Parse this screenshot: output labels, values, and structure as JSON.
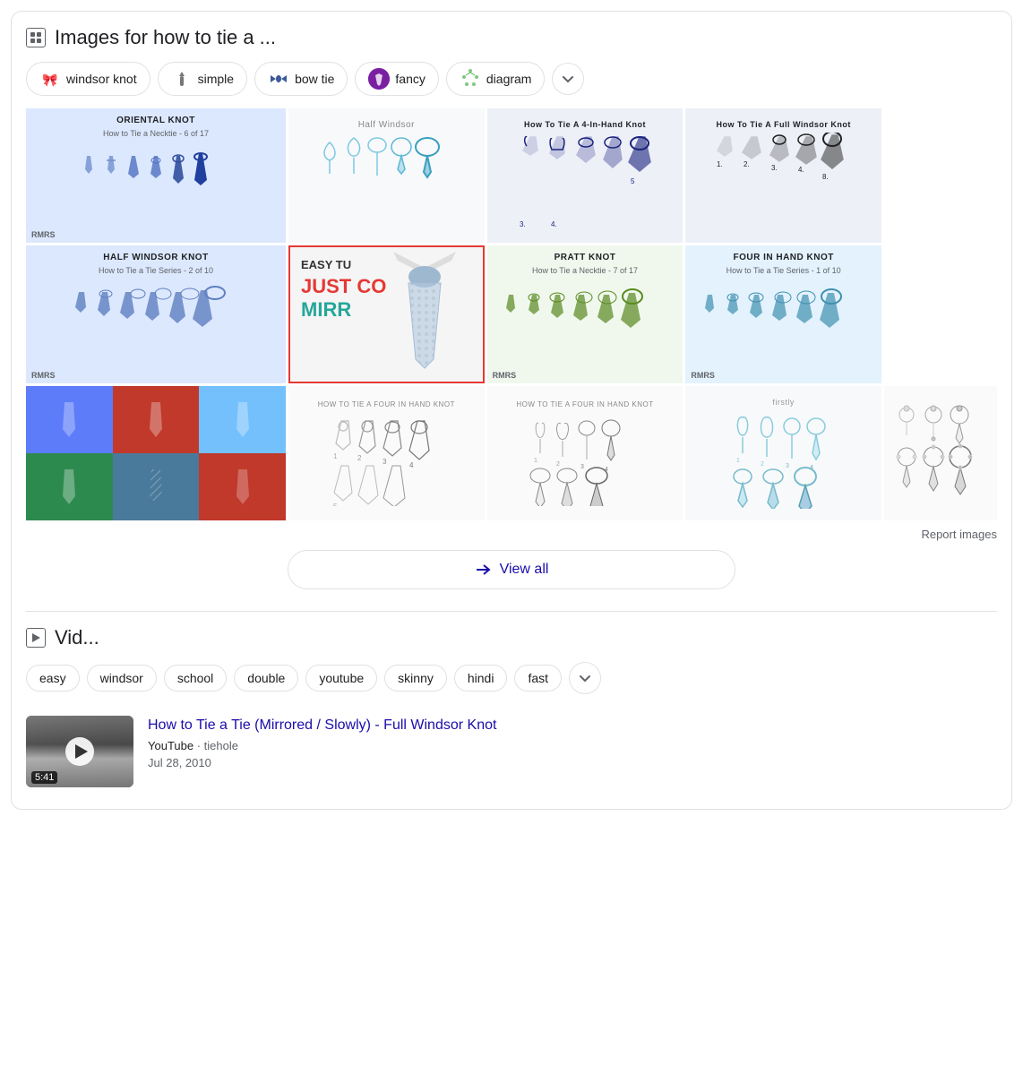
{
  "images_section": {
    "header_title": "Images for how to tie a ...",
    "header_icon": "image-icon",
    "chips": [
      {
        "label": "windsor knot",
        "icon_type": "tie-icon"
      },
      {
        "label": "simple",
        "icon_type": "tie-icon"
      },
      {
        "label": "bow tie",
        "icon_type": "tie-icon"
      },
      {
        "label": "fancy",
        "icon_type": "avatar-icon"
      },
      {
        "label": "diagram",
        "icon_type": "tie-icon"
      }
    ],
    "expand_icon": "chevron-down",
    "image_cells": [
      {
        "id": "r1c1",
        "label": "ORIENTAL KNOT",
        "sublabel": "How to Tie a Necktie - 6 of 17",
        "footer": "RMRS",
        "bg": "#e8f0fe"
      },
      {
        "id": "r1c2",
        "label": "Half Windsor",
        "sublabel": "",
        "bg": "#f8f9fa"
      },
      {
        "id": "r1c3",
        "label": "How To Tie A 4-In-Hand Knot",
        "sublabel": "",
        "bg": "#e8eaf6"
      },
      {
        "id": "r1c4",
        "label": "How To Tie A Full Windsor Knot",
        "sublabel": "",
        "bg": "#e8eaf6"
      },
      {
        "id": "r2c1",
        "label": "HALF WINDSOR KNOT",
        "sublabel": "How to Tie a Tie Series - 2 of 10",
        "footer": "RMRS",
        "bg": "#e8f0fe"
      },
      {
        "id": "r2c2",
        "label": "EASY TU",
        "text1": "JUST CO",
        "text2": "MIRR",
        "bg": "#f5f5f5",
        "has_border": true
      },
      {
        "id": "r2c3",
        "label": "PRATT KNOT",
        "sublabel": "How to Tie a Necktie - 7 of 17",
        "footer": "RMRS",
        "bg": "#f1f8e9"
      },
      {
        "id": "r2c4",
        "label": "FOUR IN HAND KNOT",
        "sublabel": "How to Tie a Tie Series - 1 of 10",
        "footer": "RMRS",
        "bg": "#e3f2fd"
      },
      {
        "id": "r3c1",
        "label": "color-grid",
        "colors": [
          "#5c7cfa",
          "#e03131",
          "#74c0fc",
          "#69db7c",
          "#94d82d",
          "#e03131"
        ],
        "bg": "#fff"
      },
      {
        "id": "r3c2",
        "label": "HOW TO TIE A FOUR IN HAND KNOT",
        "sublabel": "",
        "bg": "#fafafa"
      },
      {
        "id": "r3c3",
        "label": "HOW TO TIE A FOUR IN HAND KNOT",
        "sublabel": "",
        "bg": "#fafafa"
      },
      {
        "id": "r3c4",
        "label": "firstly",
        "sublabel": "",
        "bg": "#f8f9fa"
      },
      {
        "id": "r3c5",
        "label": "",
        "sublabel": "",
        "bg": "#fafafa"
      }
    ],
    "report_images_label": "Report images",
    "view_all_label": "View all"
  },
  "videos_section": {
    "header_title": "Vid...",
    "header_icon": "video-icon",
    "chips": [
      {
        "label": "easy"
      },
      {
        "label": "windsor"
      },
      {
        "label": "school"
      },
      {
        "label": "double"
      },
      {
        "label": "youtube"
      },
      {
        "label": "skinny"
      },
      {
        "label": "hindi"
      },
      {
        "label": "fast"
      }
    ],
    "expand_icon": "chevron-down",
    "video": {
      "title": "How to Tie a Tie (Mirrored / Slowly) - Full Windsor Knot",
      "source": "YouTube",
      "channel": "tiehole",
      "date": "Jul 28, 2010",
      "duration": "5:41"
    }
  }
}
